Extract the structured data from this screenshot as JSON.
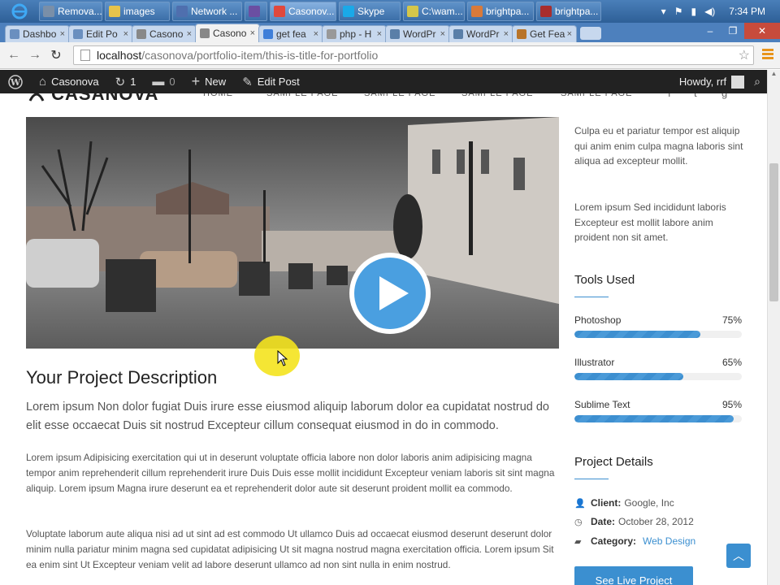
{
  "taskbar": {
    "buttons": [
      {
        "label": "Remova...",
        "color": "#7a8fa8"
      },
      {
        "label": "images",
        "color": "#e5c34b"
      },
      {
        "label": "Network ...",
        "color": "#4f6fae"
      },
      {
        "label": "",
        "color": "#6b4fa2"
      },
      {
        "label": "Casonov...",
        "color": "#e0483c"
      },
      {
        "label": "Skype",
        "color": "#1aa9e8"
      },
      {
        "label": "C:\\wam...",
        "color": "#d4c64a"
      },
      {
        "label": "brightpa...",
        "color": "#d97a3a"
      },
      {
        "label": "brightpa...",
        "color": "#a82d2d"
      }
    ],
    "clock": "7:34 PM"
  },
  "browser": {
    "tabs": [
      {
        "label": "Dashbo"
      },
      {
        "label": "Edit Po"
      },
      {
        "label": "Casono"
      },
      {
        "label": "Casono"
      },
      {
        "label": "get fea"
      },
      {
        "label": "php - H"
      },
      {
        "label": "WordPr"
      },
      {
        "label": "WordPr"
      },
      {
        "label": "Get Fea"
      }
    ],
    "url_host": "localhost",
    "url_path": "/casonova/portfolio-item/this-is-title-for-portfolio"
  },
  "adminbar": {
    "site": "Casonova",
    "updates": "1",
    "comments": "0",
    "new": "New",
    "edit": "Edit Post",
    "howdy": "Howdy, rrf"
  },
  "site": {
    "logo": "CASANOVA",
    "nav": [
      "HOME",
      "SAMPLE PAGE",
      "SAMPLE PAGE",
      "SAMPLE PAGE",
      "SAMPLE PAGE"
    ]
  },
  "main": {
    "title": "Your Project Description",
    "lead": "Lorem ipsum Non dolor fugiat Duis irure esse eiusmod aliquip laborum dolor ea cupidatat nostrud do elit esse occaecat Duis sit nostrud Excepteur cillum consequat eiusmod in do in commodo.",
    "para1": "Lorem ipsum Adipisicing exercitation qui ut in deserunt voluptate officia labore non dolor laboris anim adipisicing magna tempor anim reprehenderit cillum reprehenderit irure Duis Duis esse mollit incididunt Excepteur veniam laboris sit sint magna aliquip. Lorem ipsum Magna irure deserunt ea et reprehenderit dolor aute sit deserunt proident mollit ea commodo.",
    "para2": "Voluptate laborum aute aliqua nisi ad ut sint ad est commodo Ut ullamco Duis ad occaecat eiusmod deserunt deserunt dolor minim nulla pariatur minim magna sed cupidatat adipisicing Ut sit magna nostrud magna exercitation officia. Lorem ipsum Sit ea enim sint Ut Excepteur veniam velit ad labore deserunt ullamco ad non sint nulla in enim nostrud."
  },
  "sidebar": {
    "text1": "Culpa eu et pariatur tempor est aliquip qui anim enim culpa magna laboris sint aliqua ad excepteur mollit.",
    "text2": "Lorem ipsum Sed incididunt laboris Excepteur est mollit labore anim proident non sit amet.",
    "tools_heading": "Tools Used",
    "tools": [
      {
        "name": "Photoshop",
        "percent_label": "75%",
        "value": 75
      },
      {
        "name": "Illustrator",
        "percent_label": "65%",
        "value": 65
      },
      {
        "name": "Sublime Text",
        "percent_label": "95%",
        "value": 95
      }
    ],
    "details_heading": "Project Details",
    "details": {
      "client_label": "Client:",
      "client": "Google, Inc",
      "date_label": "Date:",
      "date": "October 28, 2012",
      "category_label": "Category:",
      "category": "Web Design"
    },
    "live_button": "See Live Project"
  },
  "colors": {
    "accent": "#3b8fd0",
    "adminbar": "#222222",
    "play": "#4a9fe0"
  }
}
